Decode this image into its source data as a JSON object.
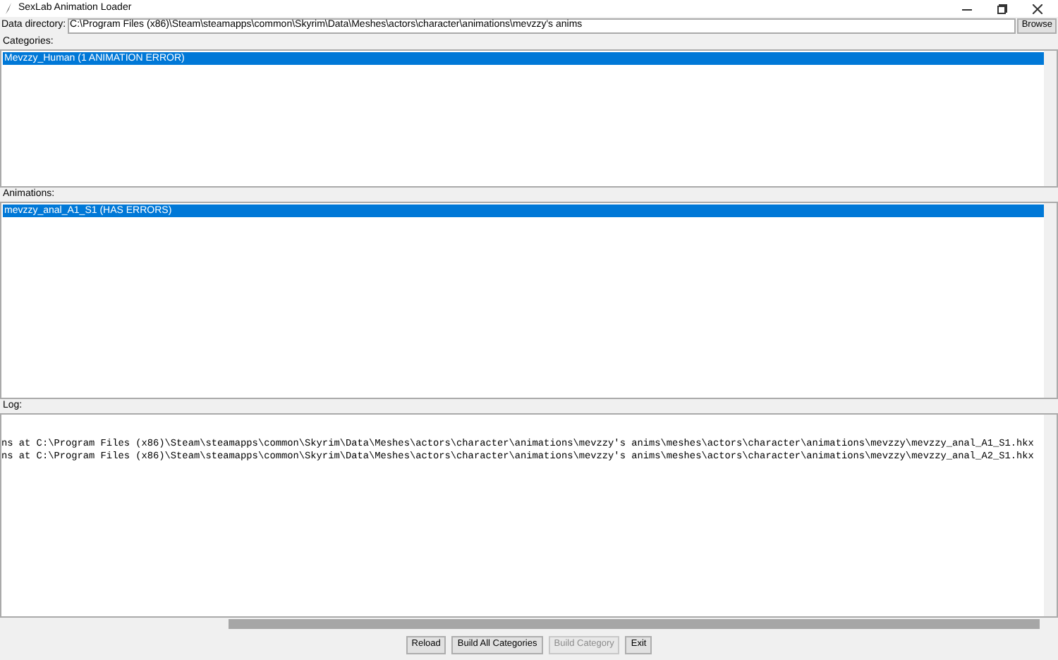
{
  "window": {
    "title": "SexLab Animation Loader"
  },
  "data_directory": {
    "label": "Data directory:",
    "value": "C:\\Program Files (x86)\\Steam\\steamapps\\common\\Skyrim\\Data\\Meshes\\actors\\character\\animations\\mevzzy's anims",
    "browse": "Browse"
  },
  "categories": {
    "label": "Categories:",
    "items": [
      {
        "text": "Mevzzy_Human  (1 ANIMATION ERROR)",
        "selected": true
      }
    ]
  },
  "animations": {
    "label": "Animations:",
    "items": [
      {
        "text": "mevzzy_anal_A1_S1  (HAS ERRORS)",
        "selected": true
      }
    ]
  },
  "log": {
    "label": "Log:",
    "lines": [
      "ns at C:\\Program Files (x86)\\Steam\\steamapps\\common\\Skyrim\\Data\\Meshes\\actors\\character\\animations\\mevzzy's anims\\meshes\\actors\\character\\animations\\mevzzy\\mevzzy_anal_A1_S1.hkx",
      "ns at C:\\Program Files (x86)\\Steam\\steamapps\\common\\Skyrim\\Data\\Meshes\\actors\\character\\animations\\mevzzy's anims\\meshes\\actors\\character\\animations\\mevzzy\\mevzzy_anal_A2_S1.hkx"
    ]
  },
  "buttons": [
    {
      "label": "Reload",
      "disabled": false
    },
    {
      "label": "Build All Categories",
      "disabled": false
    },
    {
      "label": "Build Category",
      "disabled": true
    },
    {
      "label": "Exit",
      "disabled": false
    }
  ]
}
